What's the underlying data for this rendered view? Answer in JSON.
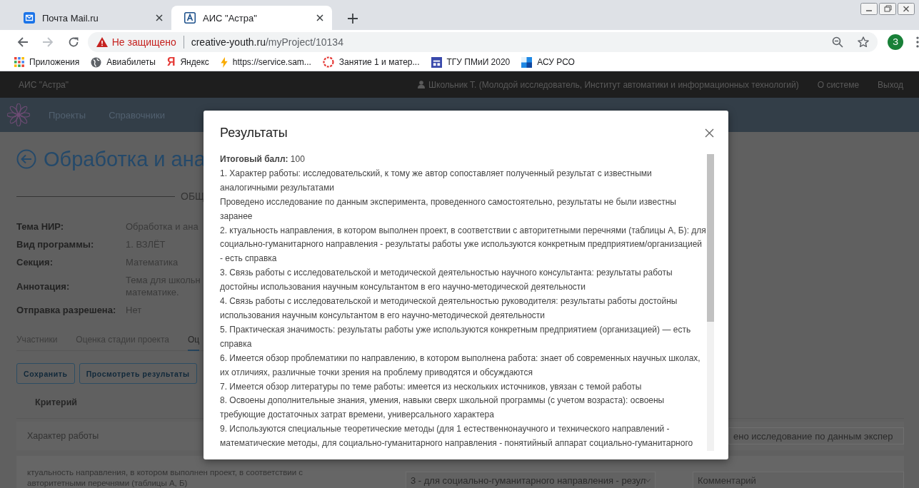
{
  "browser": {
    "tabs": [
      {
        "title": "Почта Mail.ru",
        "selected": false
      },
      {
        "title": "АИС \"Астра\"",
        "selected": true
      }
    ],
    "nav_buttons": [
      {
        "kind": "back",
        "disabled": false
      },
      {
        "kind": "forward",
        "disabled": true
      },
      {
        "kind": "reload",
        "disabled": false
      }
    ],
    "address": {
      "security": "Не защищено",
      "domain": "creative-youth.ru",
      "path": "/myProject/10134"
    },
    "profile_initial": "З",
    "bookmarks": [
      {
        "label": "Приложения"
      },
      {
        "label": "Авиабилеты"
      },
      {
        "label": "Яндекс",
        "icon_text": "Я"
      },
      {
        "label": "https://service.sam..."
      },
      {
        "label": "Занятие 1 и матер..."
      },
      {
        "label": "ТГУ ПМиИ 2020"
      },
      {
        "label": "АСУ РСО"
      }
    ]
  },
  "app": {
    "brand": "АИС \"Астра\"",
    "user": "Школьник Т. (Молодой исследователь, Институт автоматики и информационных технологий)",
    "links": [
      "О системе",
      "Выход"
    ],
    "menu": [
      "Проекты",
      "Справочники"
    ]
  },
  "project": {
    "title": "Обработка и ана",
    "section": "ОБЩ",
    "fields": [
      {
        "label": "Тема НИР:",
        "lines": [
          "Обработка и ана"
        ]
      },
      {
        "label": "Вид программы:",
        "lines": [
          "1. ВЗЛЁТ"
        ]
      },
      {
        "label": "Секция:",
        "lines": [
          "Математика"
        ]
      },
      {
        "label": "Аннотация:",
        "lines": [
          "Тема для школьн",
          "математике."
        ]
      },
      {
        "label": "Отправка разрешена:",
        "lines": [
          "Нет"
        ]
      }
    ],
    "tabs": [
      {
        "label": "Участники",
        "selected": false
      },
      {
        "label": "Оценка стадии проекта",
        "selected": false
      },
      {
        "label": "Оц",
        "selected": true
      }
    ],
    "buttons": [
      "Сохранить",
      "Просмотреть результаты"
    ],
    "table": {
      "columns": [
        "Критерий"
      ],
      "rows": [
        {
          "kind": "text",
          "criterion": [
            "Характер работы"
          ],
          "answer": "ено исследование по данным экспер"
        },
        {
          "kind": "select",
          "criterion": [
            "ктуальность направления, в котором выполнен проект, в соответствии с",
            "авторитетными перечнями (таблицы А, Б)"
          ],
          "choice": "3 - для социально-гуманитарного направления - резул",
          "comment_placeholder": "Комментарий"
        }
      ]
    }
  },
  "modal": {
    "title": "Результаты",
    "summary": "**Итоговый балл:** 100",
    "items": [
      "1. Характер работы: исследовательский, к тому же автор сопоставляет полученный результат с известными аналогичными результатами",
      "Проведено исследование по данным эксперимента, проведенного самостоятельно, результаты не были известны заранее",
      "2. ктуальность направления, в котором выполнен проект, в соответствии с авторитетными перечнями (таблицы А, Б): для социально-гуманитарного направления - результаты работы уже используются конкретным предприятием/организацией - есть справка",
      "3. Связь работы с исследовательской и методической деятельностью научного консультанта: результаты работы достойны использования научным консультантом в его научно-методической деятельности",
      "4. Связь работы с исследовательской и методической деятельностью руководителя: результаты работы достойны использования научным консультантом в его научно-методической деятельности",
      "5. Практическая значимость: результаты работы уже используются конкретным предприятием (организацией) — есть справка",
      "6. Имеется обзор проблематики по направлению, в котором выполнена работа: знает об современных научных школах, их отличиях, различные точки зрения на проблему приводятся и обсуждаются",
      "7. Имеется обзор литературы по теме работы: имеется из нескольких источников, увязан с темой работы",
      "8. Освоены дополнительные знания, умения, навыки сверх школьной программы (с учетом возраста): освоены требующие достаточных затрат времени, универсального характера",
      "9. Используются специальные теоретические методы (для 1 естественнонаучного и технического направлений - математические методы, для социально-гуманитарного направления - понятийный аппарат социально-гуманитарного"
    ]
  }
}
